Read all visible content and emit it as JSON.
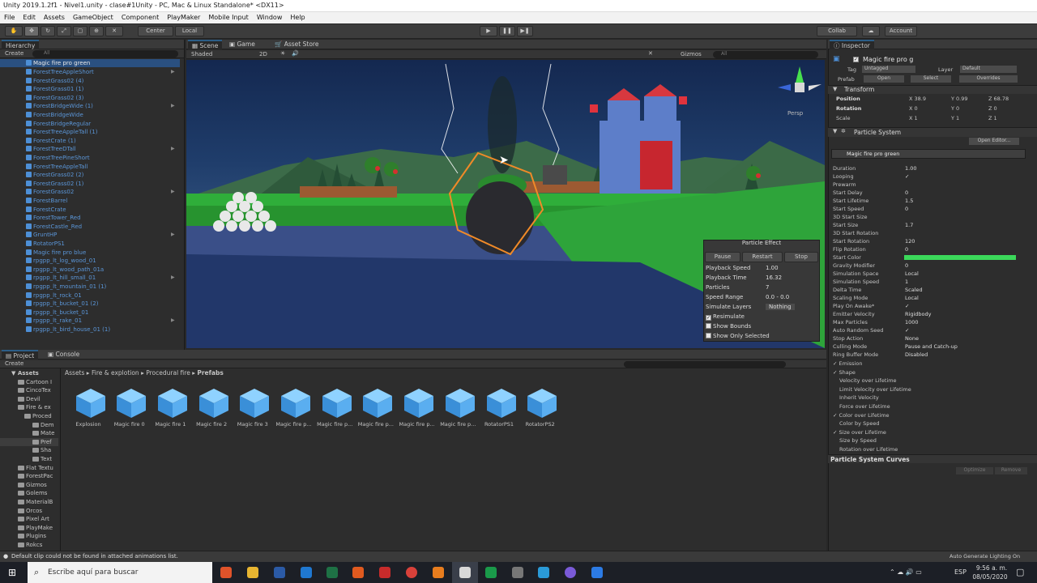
{
  "window_title": "Unity 2019.1.2f1 - Nivel1.unity - clase#1Unity - PC, Mac & Linux Standalone* <DX11>",
  "menu": [
    "File",
    "Edit",
    "Assets",
    "GameObject",
    "Component",
    "PlayMaker",
    "Mobile Input",
    "Window",
    "Help"
  ],
  "toolbar": {
    "center_label": "Center",
    "local_label": "Local",
    "collab_label": "Collab",
    "account_label": "Account"
  },
  "hierarchy": {
    "tab": "Hierarchy",
    "create_label": "Create",
    "search_label": "All",
    "items": [
      "Magic fire pro green",
      "ForestTreeAppleShort",
      "ForestGrass02 (4)",
      "ForestGrass01 (1)",
      "ForestGrass02 (3)",
      "ForestBridgeWide (1)",
      "ForestBridgeWide",
      "ForestBridgeRegular",
      "ForestTreeAppleTall (1)",
      "ForestCrate (1)",
      "ForestTreeDTall",
      "ForestTreePineShort",
      "ForestTreeAppleTall",
      "ForestGrass02 (2)",
      "ForestGrass02 (1)",
      "ForestGrass02",
      "ForestBarrel",
      "ForestCrate",
      "ForestTower_Red",
      "ForestCastle_Red",
      "GruntHP",
      "RotatorPS1",
      "Magic fire pro blue",
      "rpgpp_lt_log_wood_01",
      "rpgpp_lt_wood_path_01a",
      "rpgpp_lt_hill_small_01",
      "rpgpp_lt_mountain_01 (1)",
      "rpgpp_lt_rock_01",
      "rpgpp_lt_bucket_01 (2)",
      "rpgpp_lt_bucket_01",
      "rpgpp_lt_rake_01",
      "rpgpp_lt_bird_house_01 (1)"
    ]
  },
  "scene": {
    "tabs": [
      "Scene",
      "Game",
      "Asset Store"
    ],
    "shaded_label": "Shaded",
    "mode_label": "2D",
    "gizmos_label": "Gizmos",
    "search_label": "All",
    "persp_label": "Persp"
  },
  "particle_effect": {
    "title": "Particle Effect",
    "pause": "Pause",
    "restart": "Restart",
    "stop": "Stop",
    "rows": [
      {
        "label": "Playback Speed",
        "value": "1.00"
      },
      {
        "label": "Playback Time",
        "value": "16.32"
      },
      {
        "label": "Particles",
        "value": "7"
      },
      {
        "label": "Speed Range",
        "value": "0.0 - 0.0"
      },
      {
        "label": "Simulate Layers",
        "value": "Nothing"
      }
    ],
    "checks": [
      "Resimulate",
      "Show Bounds",
      "Show Only Selected"
    ]
  },
  "inspector": {
    "tab": "Inspector",
    "object_name": "Magic fire pro g",
    "tag_label": "Tag",
    "tag_value": "Untagged",
    "layer_label": "Layer",
    "layer_value": "Default",
    "prefab_label": "Prefab",
    "open_label": "Open",
    "select_label": "Select",
    "overrides_label": "Overrides",
    "transform_title": "Transform",
    "position_label": "Position",
    "pos": [
      "X 38.9",
      "Y 0.99",
      "Z 68.78"
    ],
    "rotation_label": "Rotation",
    "rot": [
      "X 0",
      "Y 0",
      "Z 0"
    ],
    "scale_label": "Scale",
    "scl": [
      "X 1",
      "Y 1",
      "Z 1"
    ],
    "ps_title": "Particle System",
    "open_editor": "Open Editor...",
    "ps_name": "Magic fire pro green",
    "props": [
      {
        "label": "Duration",
        "value": "1.00"
      },
      {
        "label": "Looping",
        "value": "✓"
      },
      {
        "label": "Prewarm",
        "value": ""
      },
      {
        "label": "Start Delay",
        "value": "0"
      },
      {
        "label": "Start Lifetime",
        "value": "1.5"
      },
      {
        "label": "Start Speed",
        "value": "0"
      },
      {
        "label": "3D Start Size",
        "value": ""
      },
      {
        "label": "Start Size",
        "value": "1.7"
      },
      {
        "label": "3D Start Rotation",
        "value": ""
      },
      {
        "label": "Start Rotation",
        "value": "120"
      },
      {
        "label": "Flip Rotation",
        "value": "0"
      },
      {
        "label": "Start Color",
        "value": ""
      },
      {
        "label": "Gravity Modifier",
        "value": "0"
      },
      {
        "label": "Simulation Space",
        "value": "Local"
      },
      {
        "label": "Simulation Speed",
        "value": "1"
      },
      {
        "label": "Delta Time",
        "value": "Scaled"
      },
      {
        "label": "Scaling Mode",
        "value": "Local"
      },
      {
        "label": "Play On Awake*",
        "value": "✓"
      },
      {
        "label": "Emitter Velocity",
        "value": "Rigidbody"
      },
      {
        "label": "Max Particles",
        "value": "1000"
      },
      {
        "label": "Auto Random Seed",
        "value": "✓"
      },
      {
        "label": "Stop Action",
        "value": "None"
      },
      {
        "label": "Culling Mode",
        "value": "Pause and Catch-up"
      },
      {
        "label": "Ring Buffer Mode",
        "value": "Disabled"
      }
    ],
    "modules": [
      {
        "label": "Emission",
        "checked": "✓"
      },
      {
        "label": "Shape",
        "checked": "✓"
      },
      {
        "label": "Velocity over Lifetime",
        "checked": ""
      },
      {
        "label": "Limit Velocity over Lifetime",
        "checked": ""
      },
      {
        "label": "Inherit Velocity",
        "checked": ""
      },
      {
        "label": "Force over Lifetime",
        "checked": ""
      },
      {
        "label": "Color over Lifetime",
        "checked": "✓"
      },
      {
        "label": "Color by Speed",
        "checked": ""
      },
      {
        "label": "Size over Lifetime",
        "checked": "✓"
      },
      {
        "label": "Size by Speed",
        "checked": ""
      },
      {
        "label": "Rotation over Lifetime",
        "checked": ""
      }
    ],
    "curves_title": "Particle System Curves",
    "optimize": "Optimize",
    "remove": "Remove",
    "start_color": "#3bd85a"
  },
  "project": {
    "tabs": [
      "Project",
      "Console"
    ],
    "create_label": "Create",
    "folders": [
      "Assets",
      "Cartoon I",
      "CincoTex",
      "Devil",
      "Fire & ex",
      "Proced",
      "Dem",
      "Mate",
      "Pref",
      "Sha",
      "Text",
      "Flat Textu",
      "ForestPac",
      "Gizmos",
      "Golems",
      "MaterialB",
      "Orcos",
      "Pixel Art",
      "PlayMake",
      "Plugins",
      "Rokcs"
    ],
    "breadcrumb": [
      "Assets",
      "Fire & explotion",
      "Procedural fire",
      "Prefabs"
    ],
    "assets": [
      "Explosion",
      "Magic fire 0",
      "Magic fire 1",
      "Magic fire 2",
      "Magic fire 3",
      "Magic fire p...",
      "Magic fire p...",
      "Magic fire p...",
      "Magic fire p...",
      "Magic fire p...",
      "RotatorPS1",
      "RotatorPS2"
    ]
  },
  "status": {
    "message": "Default clip could not be found in attached animations list.",
    "right": "Auto Generate Lighting On"
  },
  "taskbar": {
    "search_placeholder": "Escribe aquí para buscar",
    "lang": "ESP",
    "time": "9:56 a. m.",
    "date": "08/05/2020"
  }
}
